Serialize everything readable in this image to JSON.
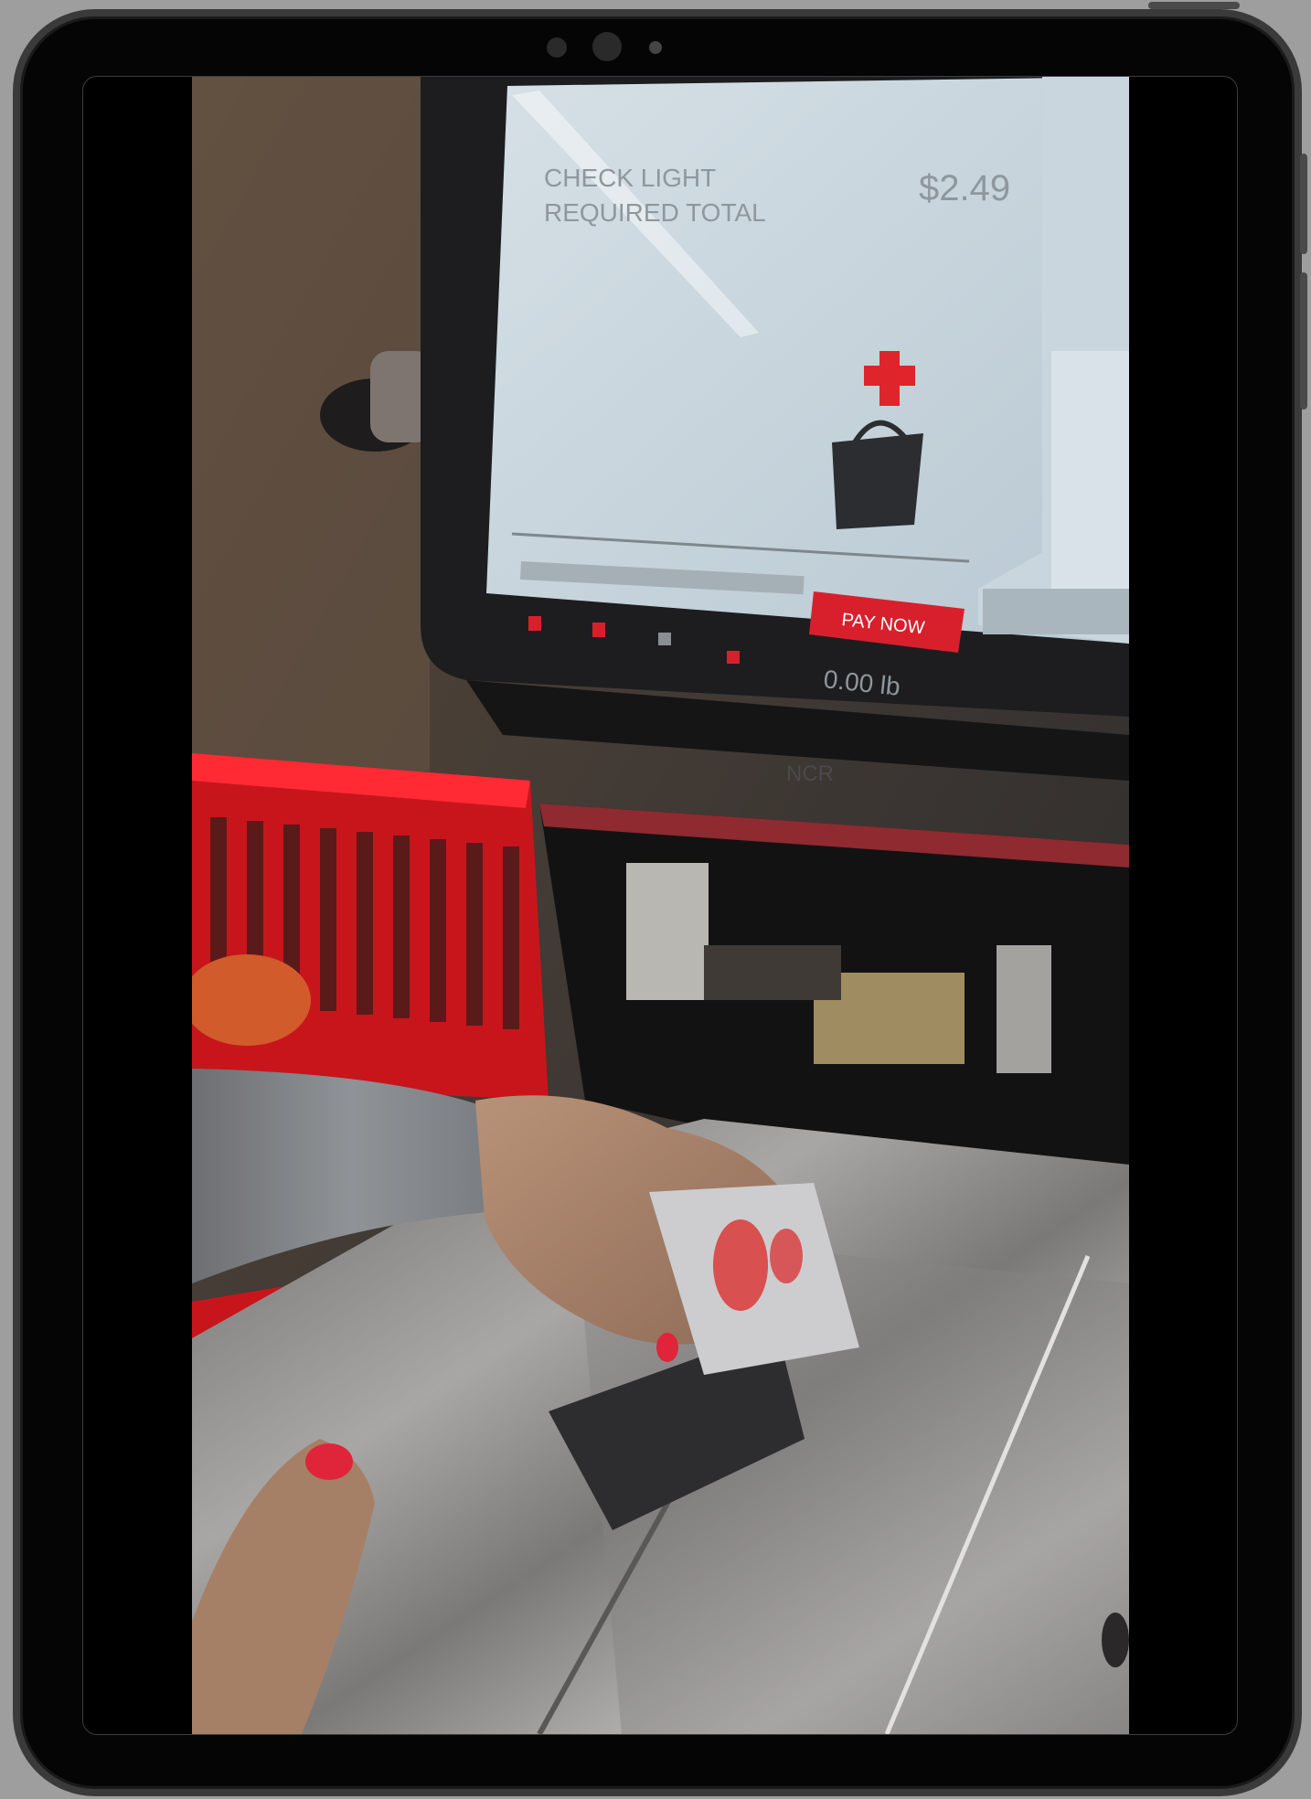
{
  "device": {
    "type": "tablet",
    "frame_color": "#050505",
    "bezel_color": "#3a3a3a"
  },
  "video": {
    "description_icon": "video-frame",
    "kiosk_screen": {
      "line1": "CHECK LIGHT",
      "line2": "REQUIRED TOTAL",
      "price": "$2.49",
      "pay_button": "PAY NOW",
      "bottom_text": "0.00 lb",
      "accent": "#d8202c"
    },
    "brand_logo": "NCR"
  }
}
